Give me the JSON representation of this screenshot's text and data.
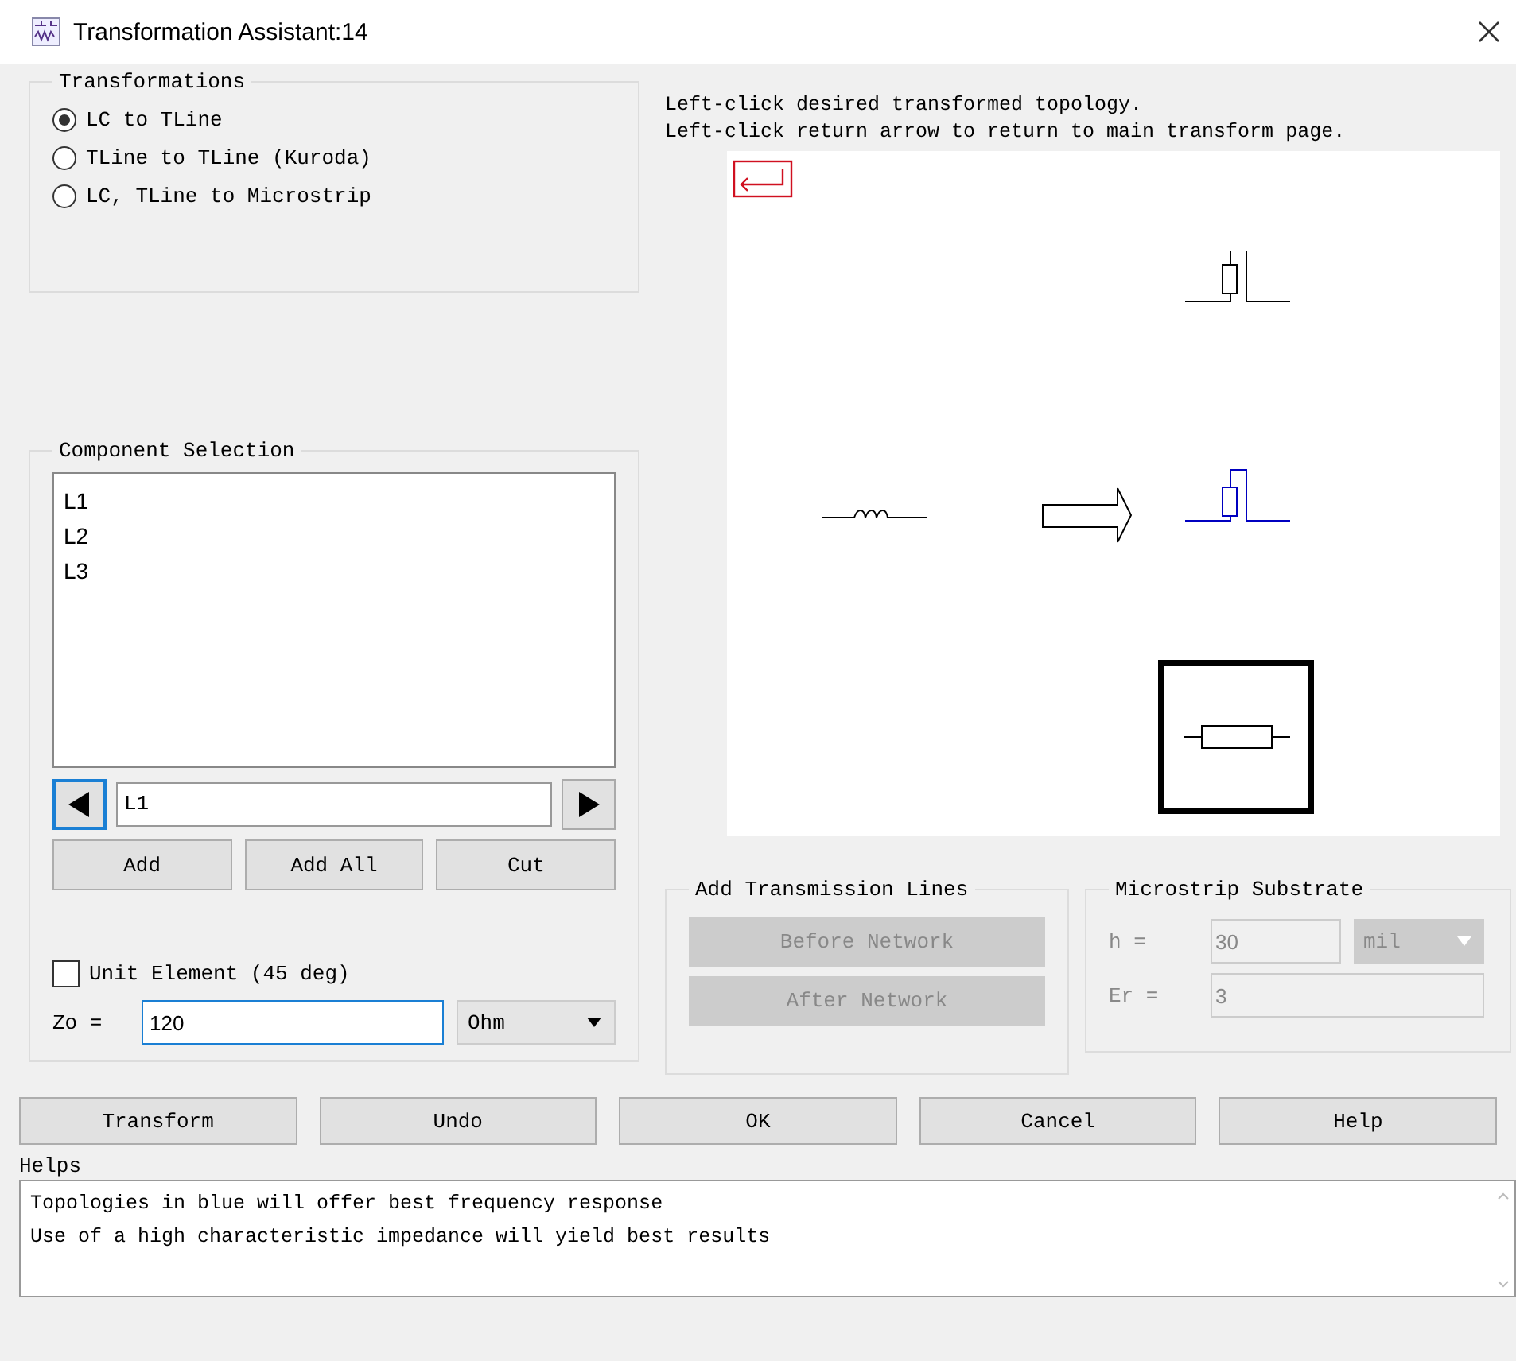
{
  "window": {
    "title": "Transformation Assistant:14"
  },
  "transformations": {
    "title": "Transformations",
    "options": [
      {
        "label": "LC to TLine",
        "selected": true
      },
      {
        "label": "TLine to TLine (Kuroda)",
        "selected": false
      },
      {
        "label": "LC, TLine to Microstrip",
        "selected": false
      }
    ]
  },
  "instructions": [
    "Left-click desired transformed topology.",
    "Left-click return arrow to return to main transform page."
  ],
  "canvas": {
    "topologies": [
      {
        "kind": "shunt-stub",
        "color": "#000000",
        "selected": false
      },
      {
        "kind": "shunt-stub-tall",
        "color": "#0000c0",
        "selected": false
      },
      {
        "kind": "series-line",
        "color": "#000000",
        "selected": true
      }
    ]
  },
  "component_selection": {
    "title": "Component Selection",
    "items": [
      "L1",
      "L2",
      "L3"
    ],
    "current": "L1",
    "buttons": [
      "Add",
      "Add All",
      "Cut"
    ]
  },
  "unit_element": {
    "label": "Unit Element (45 deg)",
    "checked": false
  },
  "zo": {
    "label": "Zo =",
    "value": "120",
    "unit": "Ohm"
  },
  "add_transmission_lines": {
    "title": "Add Transmission Lines",
    "buttons": [
      {
        "label": "Before Network",
        "disabled": true
      },
      {
        "label": "After Network",
        "disabled": true
      }
    ]
  },
  "microstrip_substrate": {
    "title": "Microstrip Substrate",
    "h_label": "h =",
    "h_value": "30",
    "h_unit": "mil",
    "er_label": "Er =",
    "er_value": "3",
    "disabled": true
  },
  "buttons": [
    "Transform",
    "Undo",
    "OK",
    "Cancel",
    "Help"
  ],
  "helps": {
    "label": "Helps",
    "lines": [
      "Topologies in blue will offer best frequency response",
      "Use of a high characteristic impedance will yield best results"
    ]
  }
}
